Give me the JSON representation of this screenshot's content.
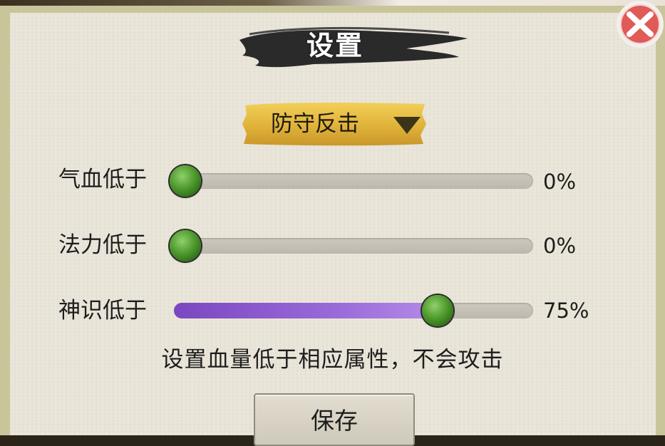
{
  "dialog": {
    "title": "设置",
    "mode_dropdown": {
      "selected": "防守反击"
    },
    "sliders": [
      {
        "label": "气血低于",
        "value_text": "0%",
        "fraction": 0.0
      },
      {
        "label": "法力低于",
        "value_text": "0%",
        "fraction": 0.0
      },
      {
        "label": "神识低于",
        "value_text": "75%",
        "fraction": 0.75
      }
    ],
    "hint": "设置血量低于相应属性，不会攻击",
    "save_label": "保存"
  },
  "icons": {
    "close": "close-icon",
    "dropdown_arrow": "triangle-down-icon"
  },
  "colors": {
    "panel_bg": "#ebe6da",
    "slider_fill": "#8a56cc",
    "thumb_green": "#4f9a2e",
    "dropdown_gold": "#e2b53c",
    "close_red": "#e05a58"
  }
}
